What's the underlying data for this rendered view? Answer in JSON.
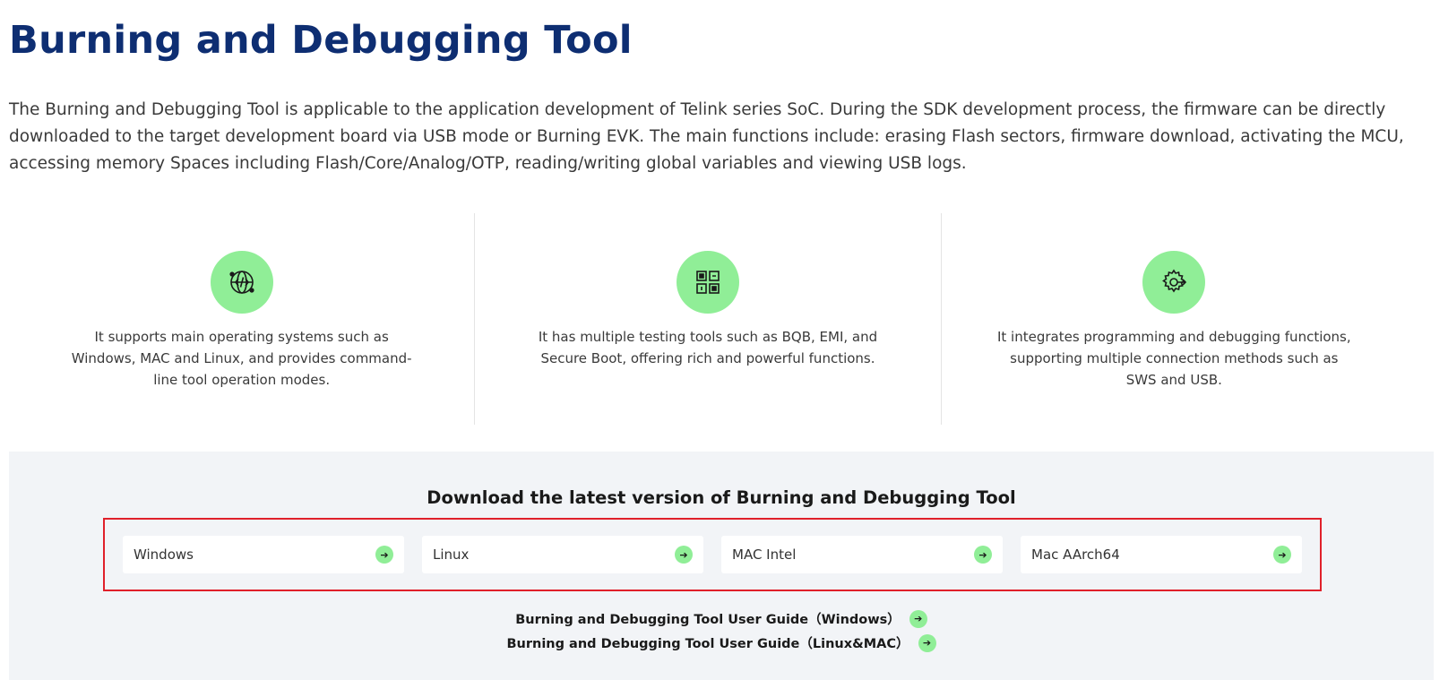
{
  "page": {
    "title": "Burning and Debugging Tool",
    "intro": "The Burning and Debugging Tool is applicable to the application development of Telink series SoC. During the SDK development process, the firmware can be directly downloaded to the target development board via USB mode or Burning EVK. The main functions include: erasing Flash sectors, firmware download, activating the MCU, accessing memory Spaces including Flash/Core/Analog/OTP, reading/writing global variables and viewing USB logs."
  },
  "features": [
    {
      "icon": "code-globe-icon",
      "text": "It supports main operating systems such as Windows, MAC and Linux, and provides command-line tool operation modes."
    },
    {
      "icon": "test-modules-icon",
      "text": "It has multiple testing tools such as BQB, EMI, and Secure Boot, offering rich and powerful functions."
    },
    {
      "icon": "gear-connect-icon",
      "text": "It integrates programming and debugging functions, supporting multiple connection methods such as SWS and USB."
    }
  ],
  "download": {
    "heading": "Download the latest version of Burning and Debugging Tool",
    "options": [
      {
        "label": "Windows"
      },
      {
        "label": "Linux"
      },
      {
        "label": "MAC Intel"
      },
      {
        "label": "Mac AArch64"
      }
    ],
    "guides": [
      {
        "label": "Burning and Debugging Tool User Guide（Windows）"
      },
      {
        "label": "Burning and Debugging Tool User Guide（Linux&MAC）"
      }
    ],
    "arrow_glyph": "➔"
  },
  "colors": {
    "title": "#0e2e72",
    "accent_green": "#90ee97",
    "highlight_border": "#e0202a",
    "section_bg": "#f2f4f7"
  }
}
